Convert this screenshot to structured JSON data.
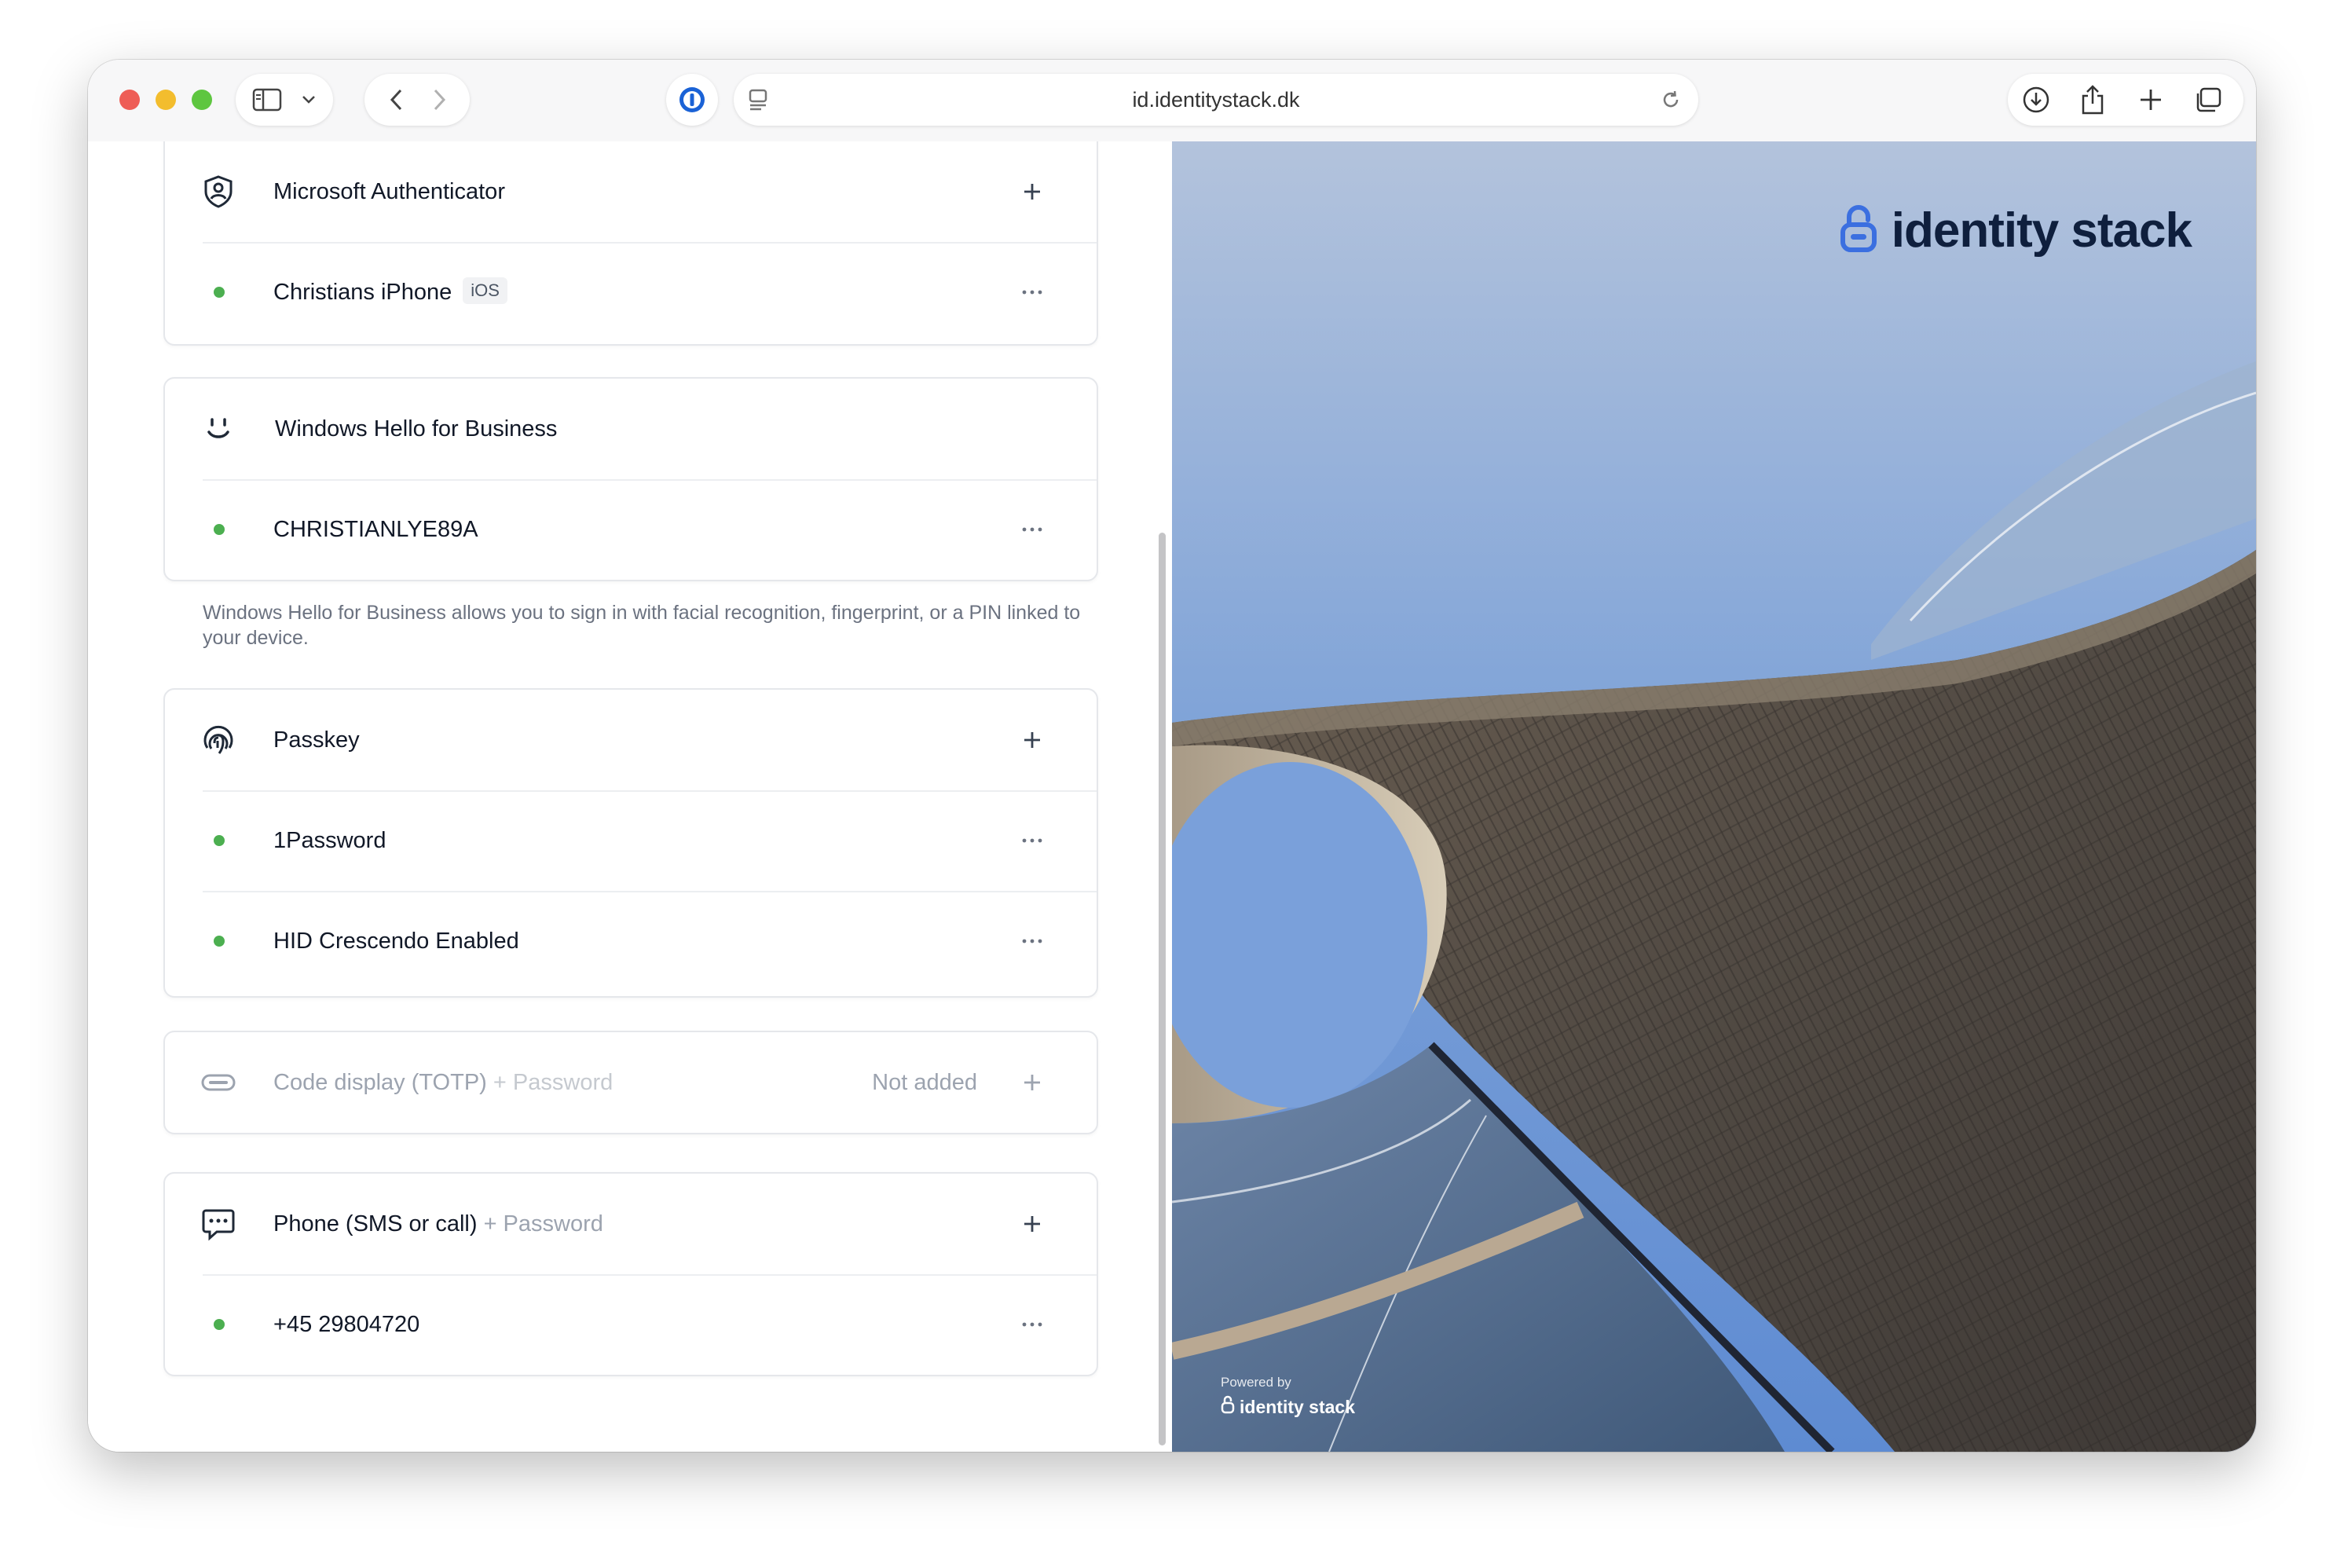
{
  "browser": {
    "url": "id.identitystack.dk"
  },
  "methods": {
    "microsoft_authenticator": {
      "label": "Microsoft Authenticator",
      "device": "Christians iPhone",
      "device_badge": "iOS"
    },
    "windows_hello": {
      "label": "Windows Hello for Business",
      "device": "CHRISTIANLYE89A",
      "help": "Windows Hello for Business allows you to sign in with facial recognition, fingerprint, or a PIN linked to your device."
    },
    "passkey": {
      "label": "Passkey",
      "devices": [
        "1Password",
        "HID Crescendo Enabled"
      ]
    },
    "totp": {
      "label": "Code display (TOTP)",
      "sub": "+ Password",
      "status": "Not added"
    },
    "phone": {
      "label": "Phone (SMS or call)",
      "sub": "+ Password",
      "number": "+45 29804720"
    }
  },
  "branding": {
    "name": "identity stack",
    "powered_by": "Powered by",
    "powered_name": "identity stack",
    "accent_color": "#3b6fe0",
    "status_active_color": "#4caf50"
  }
}
